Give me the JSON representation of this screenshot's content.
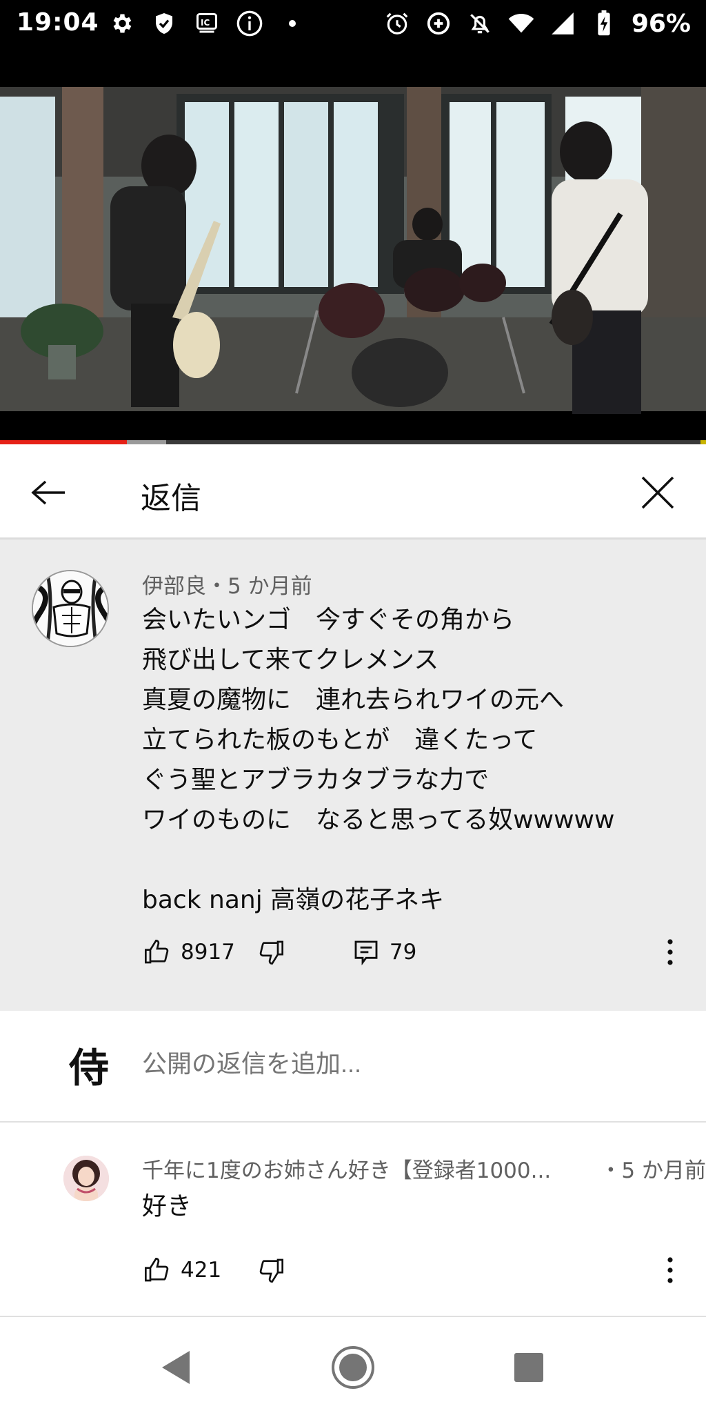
{
  "status_bar": {
    "time": "19:04",
    "battery": "96%",
    "left_icons": [
      "gear-icon",
      "shield-check-icon",
      "ic-card-icon",
      "info-icon",
      "dot-icon"
    ],
    "right_icons": [
      "alarm-icon",
      "data-saver-icon",
      "bell-off-icon",
      "wifi-icon",
      "signal-icon",
      "battery-charging-icon"
    ]
  },
  "video": {
    "progress": 0.18,
    "buffered": 0.235
  },
  "header": {
    "title": "返信",
    "back_icon": "arrow-left-icon",
    "close_icon": "close-icon"
  },
  "main_comment": {
    "author": "伊部良",
    "time": "5 か月前",
    "meta": "伊部良・5 か月前",
    "text": "会いたいンゴ　今すぐその角から\n飛び出して来てクレメンス\n真夏の魔物に　連れ去られワイの元へ\n立てられた板のもとが　違くたって\nぐう聖とアブラカタブラな力で\nワイのものに　なると思ってる奴wwwww\n\nback nanj  高嶺の花子ネキ",
    "likes": "8917",
    "replies": "79"
  },
  "add_reply": {
    "placeholder": "公開の返信を追加...",
    "avatar_char": "侍"
  },
  "reply": {
    "author": "千年に1度のお姉さん好き【登録者1000...",
    "time": "・5 か月前",
    "text": "好き",
    "likes": "421"
  },
  "colors": {
    "accent_red": "#e62117",
    "comment_bg": "#ececec",
    "meta_text": "#606060"
  }
}
